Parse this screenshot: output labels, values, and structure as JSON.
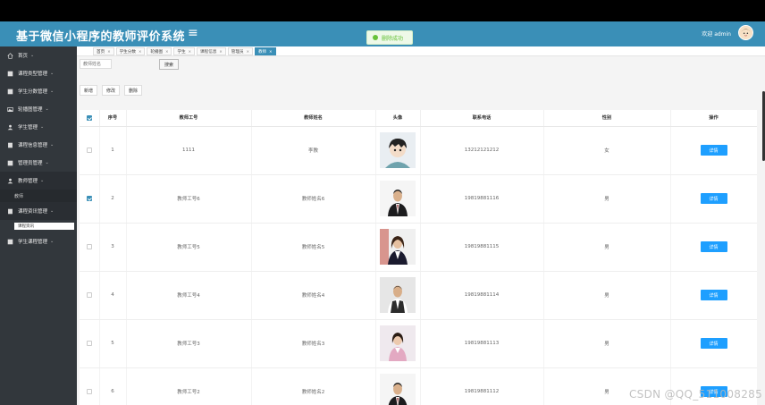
{
  "app": {
    "title": "基于微信小程序的教师评价系统",
    "welcome": "欢迎 admin",
    "toast": "删除成功"
  },
  "sidebar": {
    "items": [
      {
        "label": "首页",
        "icon": "home-icon"
      },
      {
        "label": "课程类型管理",
        "icon": "list-icon"
      },
      {
        "label": "学生分数管理",
        "icon": "list-icon"
      },
      {
        "label": "轮播图管理",
        "icon": "image-icon"
      },
      {
        "label": "学生管理",
        "icon": "user-icon"
      },
      {
        "label": "课程信息管理",
        "icon": "doc-icon"
      },
      {
        "label": "管理员管理",
        "icon": "list-icon"
      },
      {
        "label": "教师管理",
        "icon": "user-icon"
      },
      {
        "label": "课程资讯管理",
        "icon": "doc-icon"
      },
      {
        "label": "学生课程管理",
        "icon": "list-icon"
      }
    ],
    "sub_item_1": "教师",
    "sub_item_2": "课程资讯"
  },
  "tabs": [
    {
      "label": "首页"
    },
    {
      "label": "学生分数"
    },
    {
      "label": "轮播图"
    },
    {
      "label": "学生"
    },
    {
      "label": "课程信息"
    },
    {
      "label": "管理员"
    },
    {
      "label": "教师",
      "active": true
    }
  ],
  "toolbar": {
    "search_placeholder": "教师姓名",
    "search_label": "搜索",
    "add_label": "新增",
    "edit_label": "修改",
    "delete_label": "删除"
  },
  "table": {
    "headers": [
      "序号",
      "教师工号",
      "教师姓名",
      "头像",
      "联系电话",
      "性别",
      "操作"
    ],
    "rows": [
      {
        "no": "1",
        "id": "1111",
        "name": "李教",
        "phone": "13212121212",
        "gender": "女",
        "action": "详情",
        "checked": false,
        "photo": "cartoon-avatar-photo"
      },
      {
        "no": "2",
        "id": "教师工号6",
        "name": "教师姓名6",
        "phone": "19819881116",
        "gender": "男",
        "action": "详情",
        "checked": true,
        "photo": "man-in-suit-photo"
      },
      {
        "no": "3",
        "id": "教师工号5",
        "name": "教师姓名5",
        "phone": "19819881115",
        "gender": "男",
        "action": "详情",
        "checked": false,
        "photo": "woman-in-suit-photo"
      },
      {
        "no": "4",
        "id": "教师工号4",
        "name": "教师姓名4",
        "phone": "19819881114",
        "gender": "男",
        "action": "详情",
        "checked": false,
        "photo": "man-in-vest-photo"
      },
      {
        "no": "5",
        "id": "教师工号3",
        "name": "教师姓名3",
        "phone": "19819881113",
        "gender": "男",
        "action": "详情",
        "checked": false,
        "photo": "woman-in-pink-photo"
      },
      {
        "no": "6",
        "id": "教师工号2",
        "name": "教师姓名2",
        "phone": "19819881112",
        "gender": "男",
        "action": "详情",
        "checked": false,
        "photo": "man-in-suit-photo"
      }
    ]
  },
  "watermark": "CSDN @QQ_511008285",
  "colors": {
    "header": "#3a8fb7",
    "sidebar": "#32373c",
    "detail_button": "#1e9fff"
  }
}
